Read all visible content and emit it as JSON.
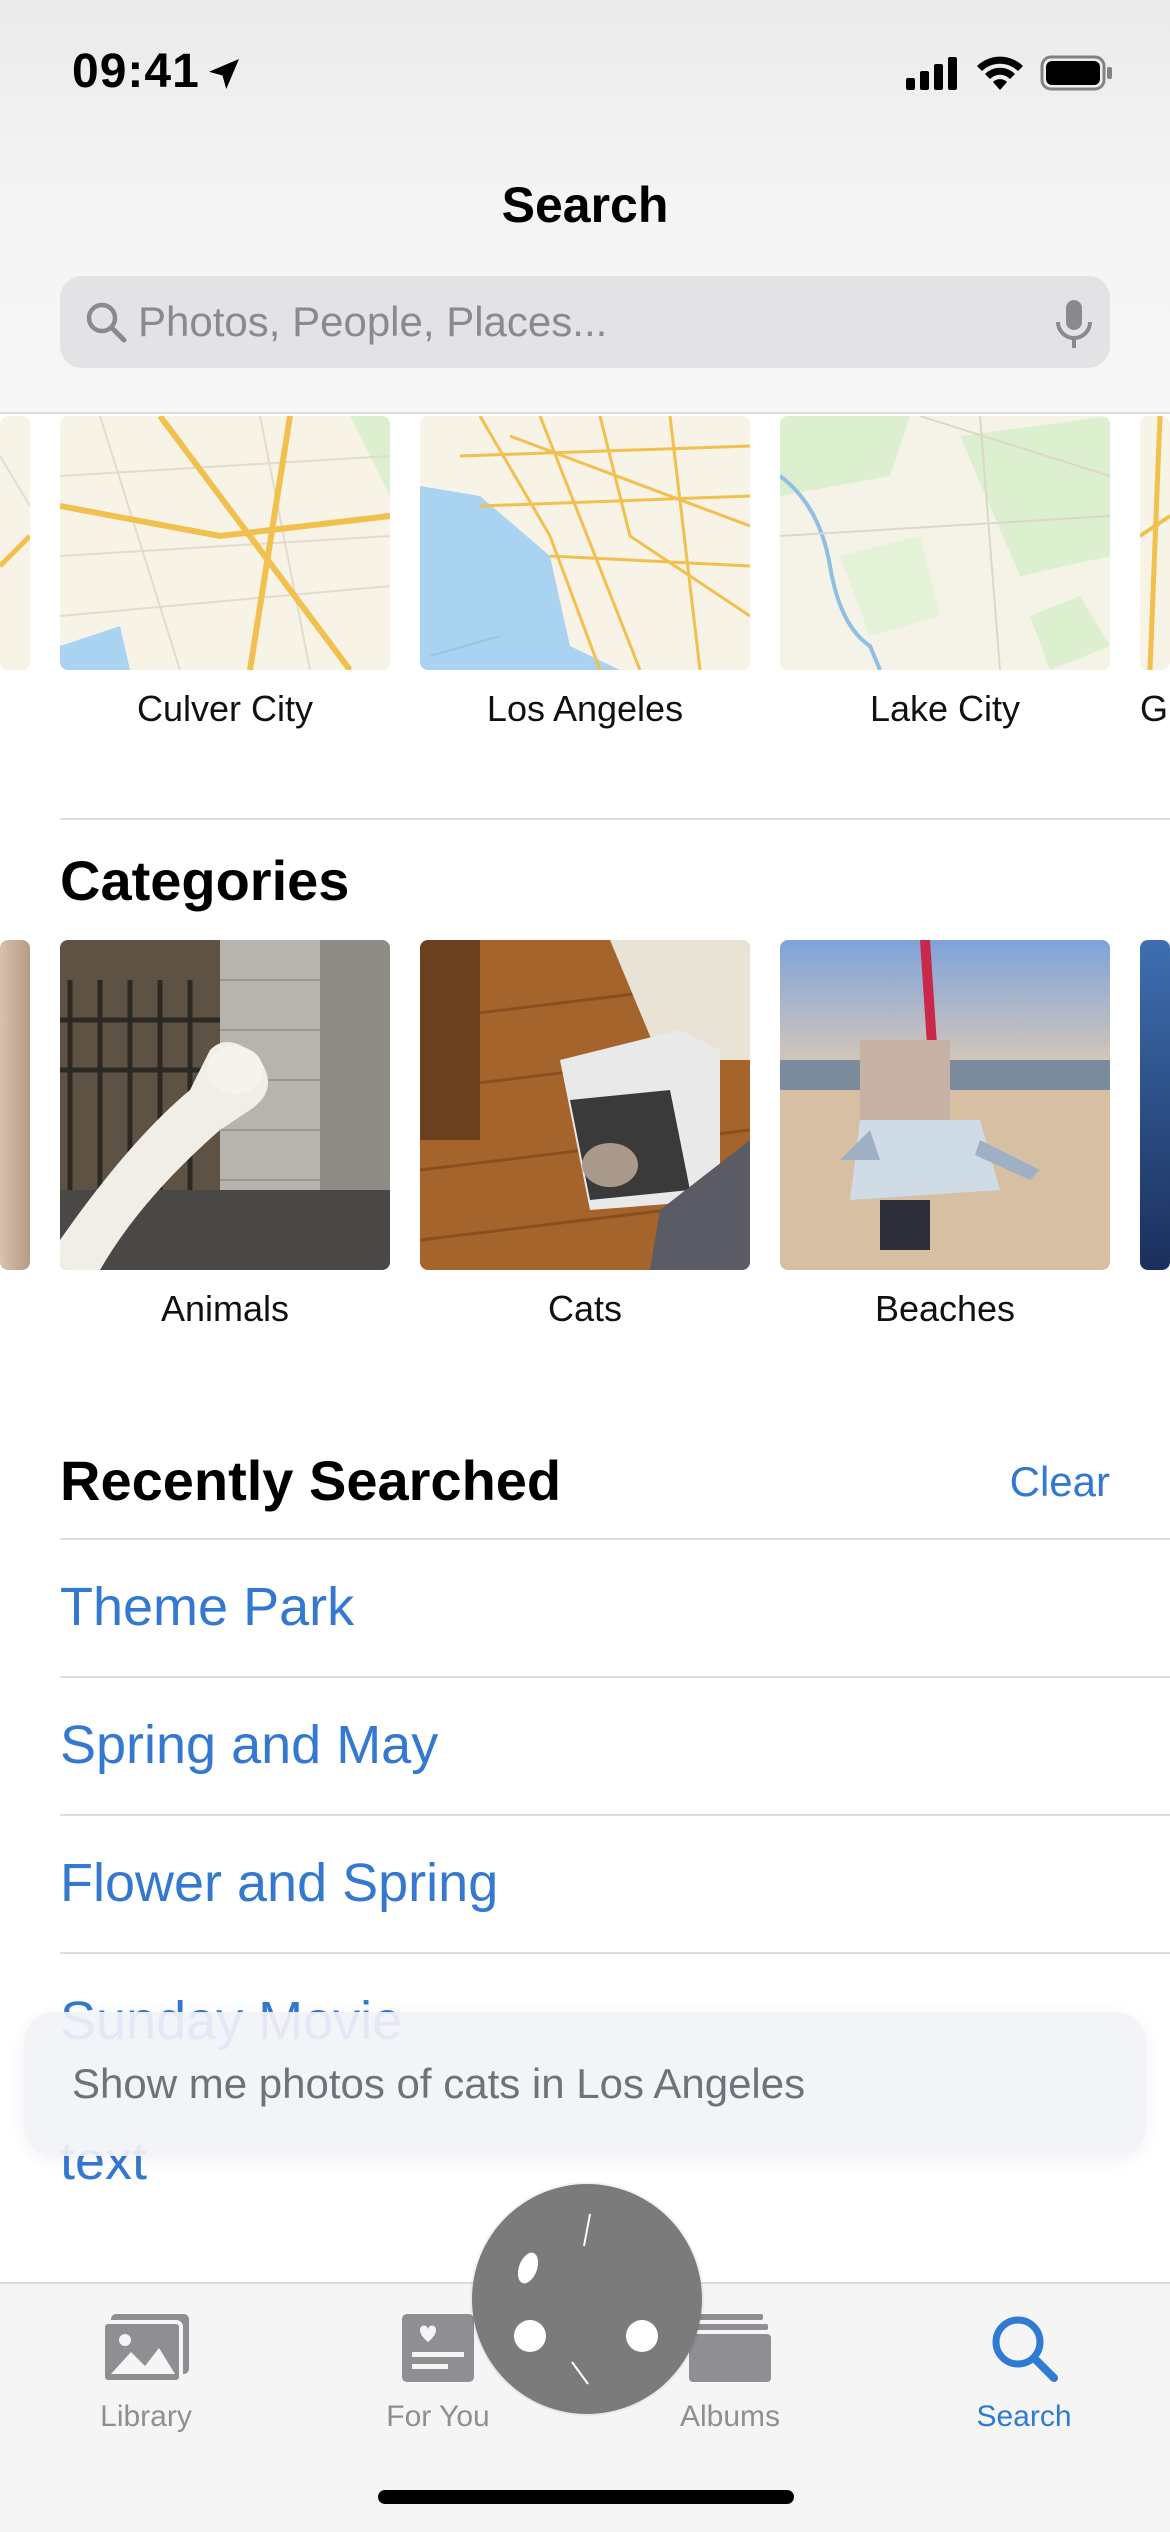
{
  "status_bar": {
    "time": "09:41"
  },
  "header": {
    "title": "Search"
  },
  "search": {
    "placeholder": "Photos, People, Places..."
  },
  "places": [
    {
      "label": "Culver City"
    },
    {
      "label": "Los Angeles"
    },
    {
      "label": "Lake City"
    },
    {
      "label": "G"
    }
  ],
  "categories": {
    "title": "Categories",
    "items": [
      {
        "label": "Animals"
      },
      {
        "label": "Cats"
      },
      {
        "label": "Beaches"
      }
    ]
  },
  "recent": {
    "title": "Recently Searched",
    "clear_label": "Clear",
    "items": [
      {
        "label": "Theme Park"
      },
      {
        "label": "Spring and May"
      },
      {
        "label": "Flower and Spring"
      },
      {
        "label": "Sunday Movie"
      },
      {
        "label": "text"
      }
    ]
  },
  "suggestion": {
    "text": "Show me photos of cats in Los Angeles"
  },
  "tabs": [
    {
      "label": "Library",
      "icon": "photo-library-icon",
      "active": false
    },
    {
      "label": "For You",
      "icon": "for-you-icon",
      "active": false
    },
    {
      "label": "Albums",
      "icon": "albums-icon",
      "active": false
    },
    {
      "label": "Search",
      "icon": "search-icon",
      "active": true
    }
  ],
  "colors": {
    "accent": "#3478d0",
    "tab_active": "#2f7ad3",
    "tab_inactive": "#8e8e93",
    "map_water": "#aad3f2",
    "map_road": "#f2c04e",
    "map_land": "#f7f3e6",
    "map_park": "#dcefcf"
  }
}
